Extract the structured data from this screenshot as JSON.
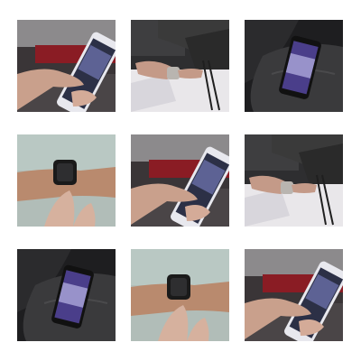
{
  "gallery": {
    "tiles": [
      {
        "name": "thumbnail-phone-in-hand",
        "alt": ""
      },
      {
        "name": "thumbnail-wrist-watch-arm",
        "alt": ""
      },
      {
        "name": "thumbnail-phone-on-seat",
        "alt": ""
      },
      {
        "name": "thumbnail-smartwatch-wrist",
        "alt": ""
      },
      {
        "name": "thumbnail-phone-in-hand",
        "alt": ""
      },
      {
        "name": "thumbnail-wrist-watch-arm",
        "alt": ""
      },
      {
        "name": "thumbnail-phone-on-seat",
        "alt": ""
      },
      {
        "name": "thumbnail-smartwatch-wrist",
        "alt": ""
      },
      {
        "name": "thumbnail-phone-in-hand",
        "alt": ""
      }
    ],
    "colors": {
      "background": "#ffffff",
      "dark_interior": "#2a2a2c",
      "red_accent": "#8a1c24",
      "skin": "#c9a08c",
      "phone_screen": "#5a5ca8",
      "jacket": "#333333"
    }
  }
}
